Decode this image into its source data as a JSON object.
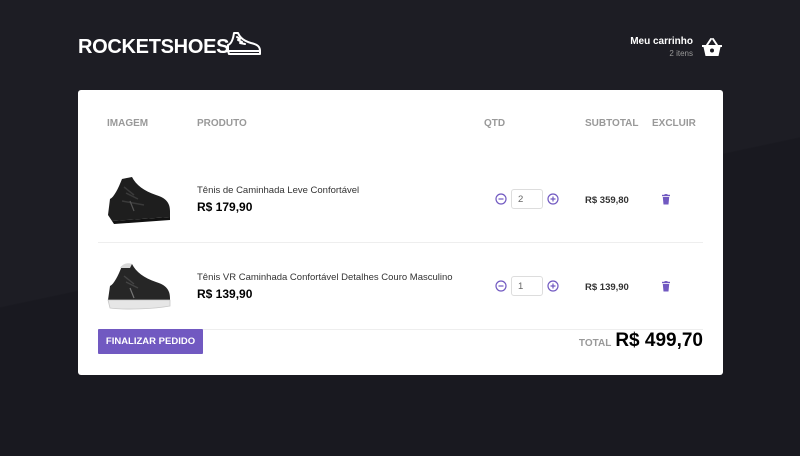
{
  "header": {
    "logo": "ROCKETSHOES",
    "cart_title": "Meu carrinho",
    "cart_count": "2 itens"
  },
  "table": {
    "headers": [
      "IMAGEM",
      "PRODUTO",
      "QTD",
      "SUBTOTAL",
      "EXCLUIR"
    ],
    "items": [
      {
        "title": "Tênis de Caminhada Leve Confortável",
        "price": "R$ 179,90",
        "quantity": "2",
        "subtotal": "R$ 359,80",
        "image": "black-sneaker"
      },
      {
        "title": "Tênis VR Caminhada Confortável Detalhes Couro Masculino",
        "price": "R$ 139,90",
        "quantity": "1",
        "subtotal": "R$ 139,90",
        "image": "black-sneaker-white-sole"
      }
    ]
  },
  "footer": {
    "finish_label": "FINALIZAR PEDIDO",
    "total_label": "TOTAL",
    "total_value": "R$ 499,70"
  },
  "colors": {
    "background": "#191920",
    "accent": "#7159c1",
    "panel": "#ffffff"
  }
}
